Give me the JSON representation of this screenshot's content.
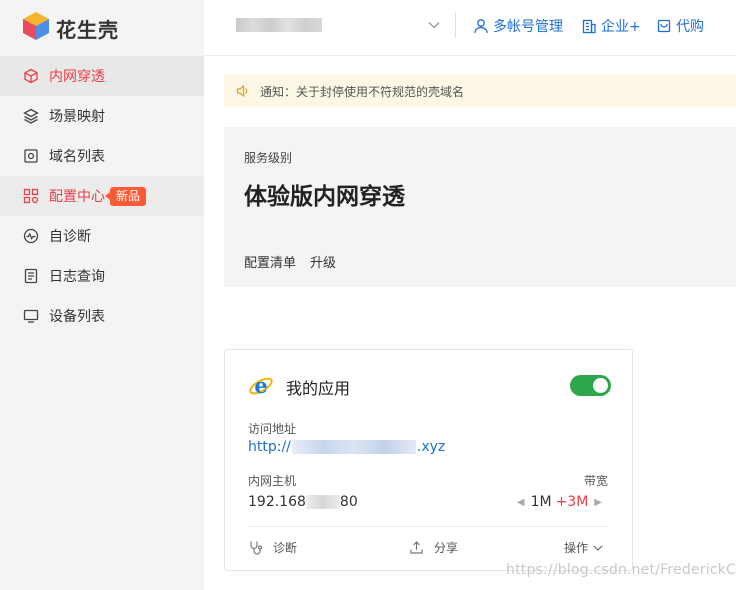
{
  "brand": {
    "name": "花生壳"
  },
  "sidebar": {
    "items": [
      {
        "label": "内网穿透",
        "icon": "cube-icon",
        "state": "active"
      },
      {
        "label": "场景映射",
        "icon": "layers-icon",
        "state": "normal"
      },
      {
        "label": "域名列表",
        "icon": "domain-icon",
        "state": "normal"
      },
      {
        "label": "配置中心",
        "icon": "grid-icon",
        "state": "highlight",
        "badge": "新品"
      },
      {
        "label": "自诊断",
        "icon": "diagnose-icon",
        "state": "normal"
      },
      {
        "label": "日志查询",
        "icon": "log-icon",
        "state": "normal"
      },
      {
        "label": "设备列表",
        "icon": "monitor-icon",
        "state": "normal"
      }
    ]
  },
  "header": {
    "links": [
      {
        "label": "多帐号管理",
        "icon": "user-icon"
      },
      {
        "label": "企业+",
        "icon": "building-icon"
      },
      {
        "label": "代购",
        "icon": "cart-icon"
      }
    ]
  },
  "notice": {
    "text": "通知：关于封停使用不符规范的壳域名"
  },
  "service": {
    "label": "服务级别",
    "title": "体验版内网穿透",
    "links": [
      "配置清单",
      "升级"
    ]
  },
  "app_card": {
    "title": "我的应用",
    "enabled": true,
    "address_label": "访问地址",
    "address_prefix": "http://",
    "address_suffix": ".xyz",
    "host_label": "内网主机",
    "host_prefix": "192.168",
    "host_suffix": "80",
    "bandwidth_label": "带宽",
    "bandwidth_base": "1M",
    "bandwidth_extra": "+3M",
    "actions": {
      "diagnose": "诊断",
      "share": "分享",
      "operate": "操作"
    }
  },
  "watermark": "https://blog.csdn.net/FrederickC",
  "colors": {
    "accent_red": "#e8404a",
    "link_blue": "#1e6fd6",
    "toggle_green": "#2ea74c",
    "badge_orange": "#ff5a36"
  }
}
